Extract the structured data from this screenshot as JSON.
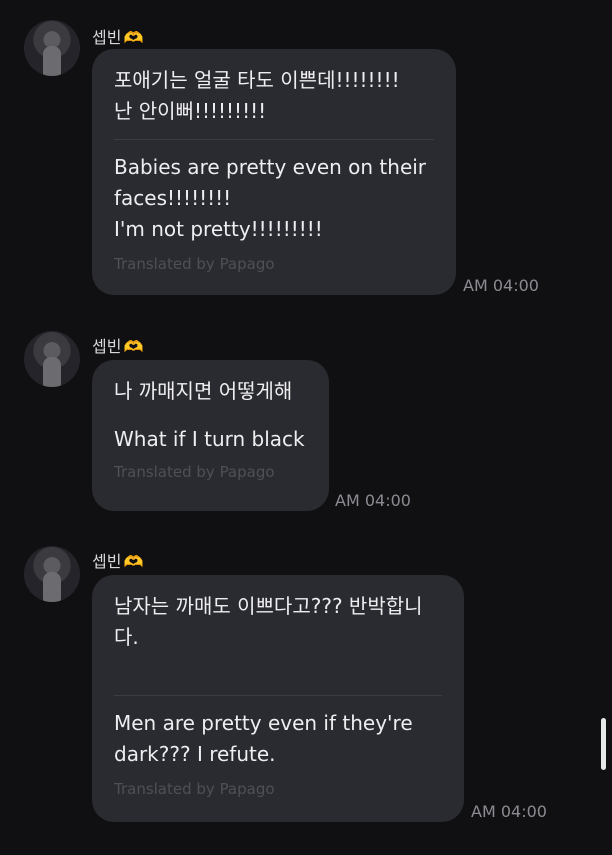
{
  "messages": [
    {
      "sender": "셉빈",
      "sender_emoji": "🫶",
      "original": "포애기는 얼굴 타도 이쁜데!!!!!!!!\n난 안이뻐!!!!!!!!!",
      "translation": "Babies are pretty even on their faces!!!!!!!!\nI'm not pretty!!!!!!!!!",
      "credit": "Translated by Papago",
      "time": "AM 04:00"
    },
    {
      "sender": "셉빈",
      "sender_emoji": "🫶",
      "original": "나 까매지면 어떻게해",
      "translation": "What if I turn black",
      "credit": "Translated by Papago",
      "time": "AM 04:00"
    },
    {
      "sender": "셉빈",
      "sender_emoji": "🫶",
      "original": "남자는 까매도 이쁘다고??? 반박합니\n다.",
      "translation": "Men are pretty even if they're dark??? I refute.",
      "credit": "Translated by Papago",
      "time": "AM 04:00"
    }
  ]
}
